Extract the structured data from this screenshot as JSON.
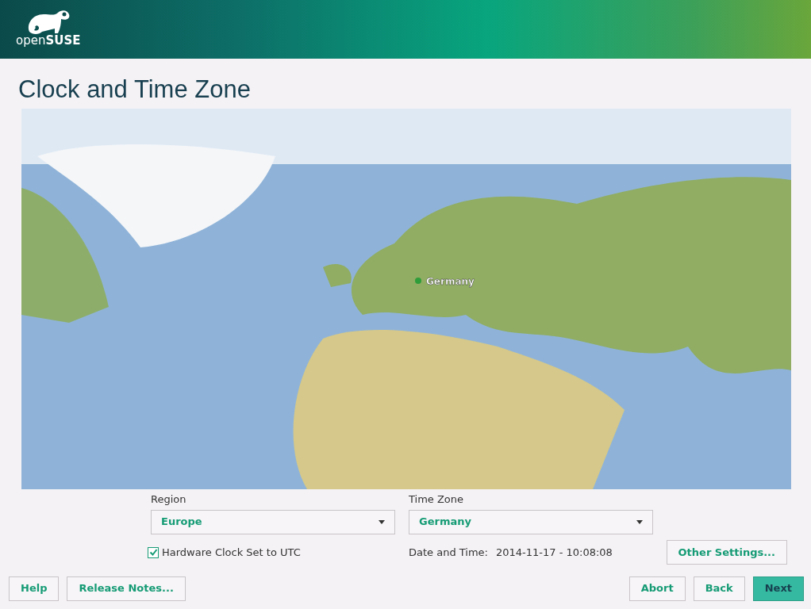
{
  "header": {
    "logo_text": "openSUSE"
  },
  "title": "Clock and Time Zone",
  "map": {
    "marker_label": "Germany"
  },
  "region": {
    "label": "Region",
    "value": "Europe"
  },
  "time_zone": {
    "label": "Time Zone",
    "value": "Germany"
  },
  "hardware_clock": {
    "label": "Hardware Clock Set to UTC",
    "checked": true
  },
  "date_time": {
    "label": "Date and Time:",
    "value": "2014-11-17 - 10:08:08"
  },
  "other_settings": {
    "label": "Other Settings..."
  },
  "left_buttons": [
    {
      "label": "Help",
      "primary": false
    },
    {
      "label": "Release Notes...",
      "primary": false
    }
  ],
  "right_buttons": [
    {
      "label": "Abort",
      "primary": false
    },
    {
      "label": "Back",
      "primary": false
    },
    {
      "label": "Next",
      "primary": true
    }
  ]
}
